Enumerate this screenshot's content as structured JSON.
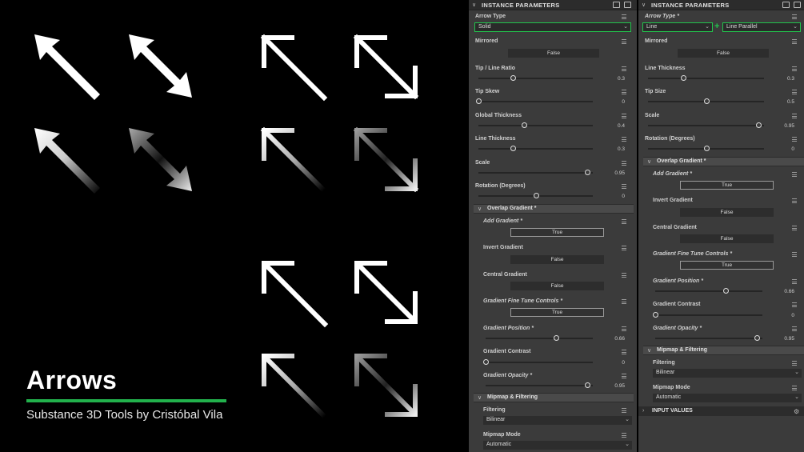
{
  "title": "Arrows",
  "subtitle": "Substance 3D Tools by Cristóbal Vila",
  "accent": "#22b14c",
  "panel1": {
    "header": "INSTANCE PARAMETERS",
    "arrow_type_label": "Arrow Type",
    "arrow_type_value": "Solid",
    "mirrored_label": "Mirrored",
    "mirrored_value": "False",
    "tip_line_ratio_label": "Tip / Line Ratio",
    "tip_line_ratio_value": "0.3",
    "tip_line_ratio_frac": 0.3,
    "tip_skew_label": "Tip Skew",
    "tip_skew_value": "0",
    "tip_skew_frac": 0,
    "global_thickness_label": "Global Thickness",
    "global_thickness_value": "0.4",
    "global_thickness_frac": 0.4,
    "line_thickness_label": "Line Thickness",
    "line_thickness_value": "0.3",
    "line_thickness_frac": 0.3,
    "scale_label": "Scale",
    "scale_value": "0.95",
    "scale_frac": 0.95,
    "rotation_label": "Rotation (Degrees)",
    "rotation_value": "0",
    "rotation_frac": 0.5,
    "overlap_group": "Overlap Gradient *",
    "add_gradient_label": "Add Gradient *",
    "add_gradient_value": "True",
    "invert_gradient_label": "Invert Gradient",
    "invert_gradient_value": "False",
    "central_gradient_label": "Central Gradient",
    "central_gradient_value": "False",
    "fine_tune_label": "Gradient Fine Tune Controls *",
    "fine_tune_value": "True",
    "grad_pos_label": "Gradient Position *",
    "grad_pos_value": "0.66",
    "grad_pos_frac": 0.66,
    "grad_contrast_label": "Gradient Contrast",
    "grad_contrast_value": "0",
    "grad_contrast_frac": 0,
    "grad_opacity_label": "Gradient Opacity *",
    "grad_opacity_value": "0.95",
    "grad_opacity_frac": 0.95,
    "mipmap_group": "Mipmap & Filtering",
    "filtering_label": "Filtering",
    "filtering_value": "Bilinear",
    "mipmap_mode_label": "Mipmap Mode",
    "mipmap_mode_value": "Automatic"
  },
  "panel2": {
    "header": "INSTANCE PARAMETERS",
    "arrow_type_label": "Arrow Type *",
    "arrow_type_value": "Line",
    "arrow_type_value2": "Line Parallel",
    "mirrored_label": "Mirrored",
    "mirrored_value": "False",
    "line_thickness_label": "Line Thickness",
    "line_thickness_value": "0.3",
    "line_thickness_frac": 0.3,
    "tip_size_label": "Tip Size",
    "tip_size_value": "0.5",
    "tip_size_frac": 0.5,
    "scale_label": "Scale",
    "scale_value": "0.95",
    "scale_frac": 0.95,
    "rotation_label": "Rotation (Degrees)",
    "rotation_value": "0",
    "rotation_frac": 0.5,
    "overlap_group": "Overlap Gradient *",
    "add_gradient_label": "Add Gradient *",
    "add_gradient_value": "True",
    "invert_gradient_label": "Invert Gradient",
    "invert_gradient_value": "False",
    "central_gradient_label": "Central Gradient",
    "central_gradient_value": "False",
    "fine_tune_label": "Gradient Fine Tune Controls *",
    "fine_tune_value": "True",
    "grad_pos_label": "Gradient Position *",
    "grad_pos_value": "0.66",
    "grad_pos_frac": 0.66,
    "grad_contrast_label": "Gradient Contrast",
    "grad_contrast_value": "0",
    "grad_contrast_frac": 0,
    "grad_opacity_label": "Gradient Opacity *",
    "grad_opacity_value": "0.95",
    "grad_opacity_frac": 0.95,
    "mipmap_group": "Mipmap & Filtering",
    "filtering_label": "Filtering",
    "filtering_value": "Bilinear",
    "mipmap_mode_label": "Mipmap Mode",
    "mipmap_mode_value": "Automatic",
    "input_values_group": "INPUT VALUES"
  }
}
